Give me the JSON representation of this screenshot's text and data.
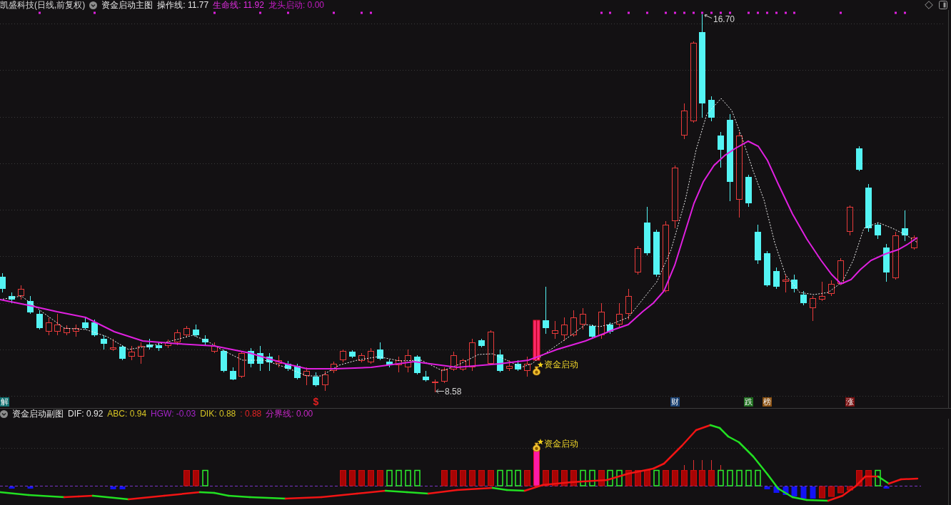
{
  "header": {
    "title": "凯盛科技(日线,前复权)",
    "indicator": "资金启动主图",
    "readings": [
      {
        "label": "操作线: 11.77",
        "color": "#e6e6e6"
      },
      {
        "label": "生命线: 11.92",
        "color": "#e22ee2"
      },
      {
        "label": "龙头启动: 0.00",
        "color": "#c41cc4"
      }
    ]
  },
  "main_chart": {
    "high_label": "16.70",
    "low_label": "8.58",
    "signal_label": "资金启动",
    "event_markers": [
      {
        "kind": "badge",
        "text": "解",
        "color": "#0f7070"
      },
      {
        "kind": "glyph",
        "text": "$",
        "color": "#e02020"
      },
      {
        "kind": "badge",
        "text": "财",
        "color": "#1b4273"
      },
      {
        "kind": "badge",
        "text": "跌",
        "color": "#1f6e1f"
      },
      {
        "kind": "badge",
        "text": "榜",
        "color": "#8c5212"
      },
      {
        "kind": "badge",
        "text": "涨",
        "color": "#7a1010"
      }
    ]
  },
  "sub_chart": {
    "indicator": "资金启动副图",
    "readings": [
      {
        "label": "DIF: 0.92",
        "color": "#e6e6e6"
      },
      {
        "label": "ABC: 0.94",
        "color": "#d6c424"
      },
      {
        "label": "HGW: -0.03",
        "color": "#a424c8"
      },
      {
        "label": "DIK: 0.88",
        "color": "#d6c424"
      },
      {
        "label": ": 0.88",
        "color": "#e22424"
      },
      {
        "label": "分界线: 0.00",
        "color": "#c828c8"
      }
    ],
    "signal_label": "资金启动"
  }
}
